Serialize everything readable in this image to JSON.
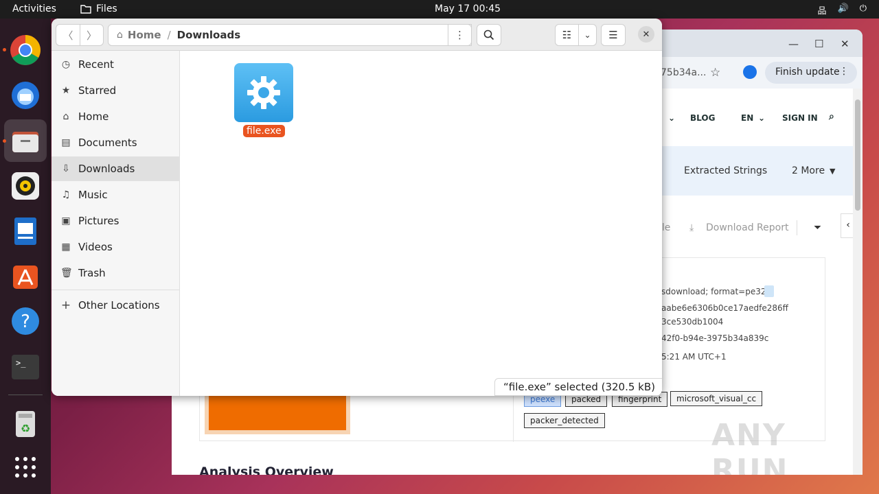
{
  "topbar": {
    "activities": "Activities",
    "app_name": "Files",
    "clock": "May 17  00:45"
  },
  "dock": {
    "apps": [
      "chrome-icon",
      "thunderbird-icon",
      "files-icon",
      "rhythmbox-icon",
      "writer-icon",
      "app-center-icon",
      "help-icon",
      "terminal-icon",
      "trash-icon",
      "app-grid-icon"
    ]
  },
  "browser": {
    "url_fragment": "75b34a...",
    "finish_update": "Finish update",
    "nav": {
      "blog": "BLOG",
      "lang": "EN",
      "signin": "SIGN IN"
    },
    "tabs": {
      "extracted": "Extracted Strings",
      "more": "2 More"
    },
    "toolbar": {
      "partial": "ile",
      "download_report": "Download Report"
    },
    "details": {
      "line1": "sdownload; format=pe32",
      "line2": "aabe6e6306b0ce17aedfe286ff",
      "line3": "3ce530db1004",
      "line4": "42f0-b94e-3975b34a839c",
      "line5": "5:21 AM UTC+1"
    },
    "tags": [
      "peexe",
      "packed",
      "fingerprint",
      "microsoft_visual_cc",
      "packer_detected"
    ],
    "analysis_heading": "Analysis Overview",
    "watermark": "ANY RUN"
  },
  "files": {
    "path": {
      "home": "Home",
      "sep": "/",
      "current": "Downloads"
    },
    "sidebar": [
      {
        "label": "Recent",
        "icon": "clock-icon",
        "glyph": "◷"
      },
      {
        "label": "Starred",
        "icon": "star-icon",
        "glyph": "★"
      },
      {
        "label": "Home",
        "icon": "home-icon",
        "glyph": "⌂"
      },
      {
        "label": "Documents",
        "icon": "document-icon",
        "glyph": "▤"
      },
      {
        "label": "Downloads",
        "icon": "download-icon",
        "glyph": "⇩"
      },
      {
        "label": "Music",
        "icon": "music-icon",
        "glyph": "♫"
      },
      {
        "label": "Pictures",
        "icon": "picture-icon",
        "glyph": "▣"
      },
      {
        "label": "Videos",
        "icon": "video-icon",
        "glyph": "▦"
      },
      {
        "label": "Trash",
        "icon": "trash-icon",
        "glyph": "🗑"
      }
    ],
    "other_locations": "Other Locations",
    "file": {
      "name": "file.exe"
    },
    "status": "“file.exe” selected  (320.5 kB)"
  },
  "colors": {
    "accent": "#e95420",
    "file_icon": "#2b9be0"
  }
}
